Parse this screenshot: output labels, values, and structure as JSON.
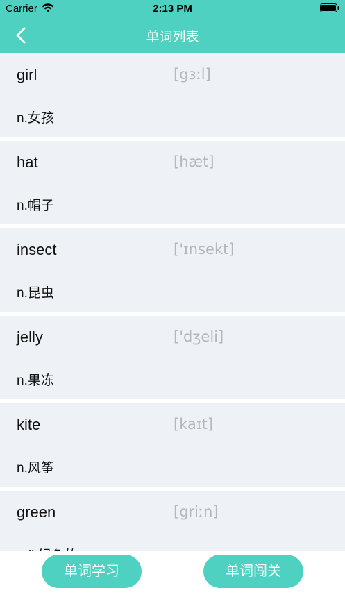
{
  "status": {
    "carrier": "Carrier",
    "time": "2:13 PM"
  },
  "nav": {
    "title": "单词列表",
    "back_icon": "chevron-left-icon"
  },
  "words": [
    {
      "word": "girl",
      "phonetic": "[gɜːl]",
      "meaning": "n.女孩"
    },
    {
      "word": "hat",
      "phonetic": "[hæt]",
      "meaning": "n.帽子"
    },
    {
      "word": "insect",
      "phonetic": "['ɪnsekt]",
      "meaning": "n.昆虫"
    },
    {
      "word": "jelly",
      "phonetic": "['dʒeli]",
      "meaning": "n.果冻"
    },
    {
      "word": "kite",
      "phonetic": "[kaɪt]",
      "meaning": "n.风筝"
    },
    {
      "word": "green",
      "phonetic": "[griːn]",
      "meaning": "adj.绿色的"
    }
  ],
  "buttons": {
    "study": "单词学习",
    "challenge": "单词闯关"
  },
  "colors": {
    "accent": "#4fd1c1",
    "card_bg": "#eef1f5",
    "phonetic": "#b4b8bd"
  }
}
